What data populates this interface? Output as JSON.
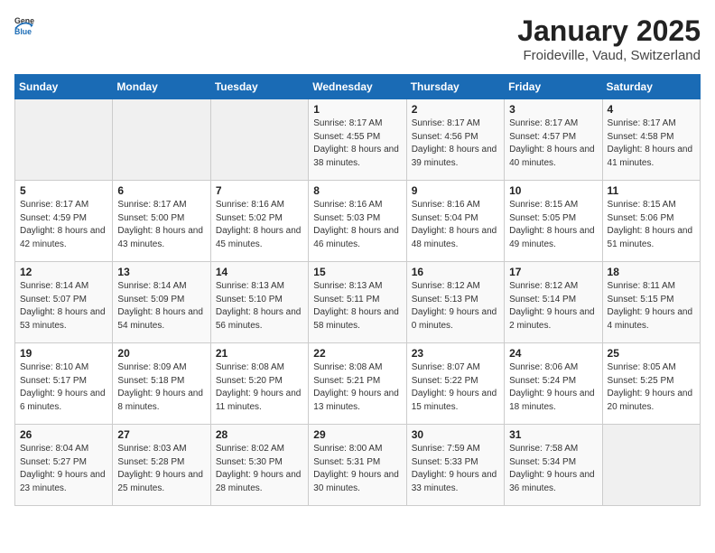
{
  "header": {
    "logo_general": "General",
    "logo_blue": "Blue",
    "title": "January 2025",
    "subtitle": "Froideville, Vaud, Switzerland"
  },
  "days_of_week": [
    "Sunday",
    "Monday",
    "Tuesday",
    "Wednesday",
    "Thursday",
    "Friday",
    "Saturday"
  ],
  "weeks": [
    [
      {
        "day": "",
        "sunrise": "",
        "sunset": "",
        "daylight": "",
        "empty": true
      },
      {
        "day": "",
        "sunrise": "",
        "sunset": "",
        "daylight": "",
        "empty": true
      },
      {
        "day": "",
        "sunrise": "",
        "sunset": "",
        "daylight": "",
        "empty": true
      },
      {
        "day": "1",
        "sunrise": "Sunrise: 8:17 AM",
        "sunset": "Sunset: 4:55 PM",
        "daylight": "Daylight: 8 hours and 38 minutes."
      },
      {
        "day": "2",
        "sunrise": "Sunrise: 8:17 AM",
        "sunset": "Sunset: 4:56 PM",
        "daylight": "Daylight: 8 hours and 39 minutes."
      },
      {
        "day": "3",
        "sunrise": "Sunrise: 8:17 AM",
        "sunset": "Sunset: 4:57 PM",
        "daylight": "Daylight: 8 hours and 40 minutes."
      },
      {
        "day": "4",
        "sunrise": "Sunrise: 8:17 AM",
        "sunset": "Sunset: 4:58 PM",
        "daylight": "Daylight: 8 hours and 41 minutes."
      }
    ],
    [
      {
        "day": "5",
        "sunrise": "Sunrise: 8:17 AM",
        "sunset": "Sunset: 4:59 PM",
        "daylight": "Daylight: 8 hours and 42 minutes."
      },
      {
        "day": "6",
        "sunrise": "Sunrise: 8:17 AM",
        "sunset": "Sunset: 5:00 PM",
        "daylight": "Daylight: 8 hours and 43 minutes."
      },
      {
        "day": "7",
        "sunrise": "Sunrise: 8:16 AM",
        "sunset": "Sunset: 5:02 PM",
        "daylight": "Daylight: 8 hours and 45 minutes."
      },
      {
        "day": "8",
        "sunrise": "Sunrise: 8:16 AM",
        "sunset": "Sunset: 5:03 PM",
        "daylight": "Daylight: 8 hours and 46 minutes."
      },
      {
        "day": "9",
        "sunrise": "Sunrise: 8:16 AM",
        "sunset": "Sunset: 5:04 PM",
        "daylight": "Daylight: 8 hours and 48 minutes."
      },
      {
        "day": "10",
        "sunrise": "Sunrise: 8:15 AM",
        "sunset": "Sunset: 5:05 PM",
        "daylight": "Daylight: 8 hours and 49 minutes."
      },
      {
        "day": "11",
        "sunrise": "Sunrise: 8:15 AM",
        "sunset": "Sunset: 5:06 PM",
        "daylight": "Daylight: 8 hours and 51 minutes."
      }
    ],
    [
      {
        "day": "12",
        "sunrise": "Sunrise: 8:14 AM",
        "sunset": "Sunset: 5:07 PM",
        "daylight": "Daylight: 8 hours and 53 minutes."
      },
      {
        "day": "13",
        "sunrise": "Sunrise: 8:14 AM",
        "sunset": "Sunset: 5:09 PM",
        "daylight": "Daylight: 8 hours and 54 minutes."
      },
      {
        "day": "14",
        "sunrise": "Sunrise: 8:13 AM",
        "sunset": "Sunset: 5:10 PM",
        "daylight": "Daylight: 8 hours and 56 minutes."
      },
      {
        "day": "15",
        "sunrise": "Sunrise: 8:13 AM",
        "sunset": "Sunset: 5:11 PM",
        "daylight": "Daylight: 8 hours and 58 minutes."
      },
      {
        "day": "16",
        "sunrise": "Sunrise: 8:12 AM",
        "sunset": "Sunset: 5:13 PM",
        "daylight": "Daylight: 9 hours and 0 minutes."
      },
      {
        "day": "17",
        "sunrise": "Sunrise: 8:12 AM",
        "sunset": "Sunset: 5:14 PM",
        "daylight": "Daylight: 9 hours and 2 minutes."
      },
      {
        "day": "18",
        "sunrise": "Sunrise: 8:11 AM",
        "sunset": "Sunset: 5:15 PM",
        "daylight": "Daylight: 9 hours and 4 minutes."
      }
    ],
    [
      {
        "day": "19",
        "sunrise": "Sunrise: 8:10 AM",
        "sunset": "Sunset: 5:17 PM",
        "daylight": "Daylight: 9 hours and 6 minutes."
      },
      {
        "day": "20",
        "sunrise": "Sunrise: 8:09 AM",
        "sunset": "Sunset: 5:18 PM",
        "daylight": "Daylight: 9 hours and 8 minutes."
      },
      {
        "day": "21",
        "sunrise": "Sunrise: 8:08 AM",
        "sunset": "Sunset: 5:20 PM",
        "daylight": "Daylight: 9 hours and 11 minutes."
      },
      {
        "day": "22",
        "sunrise": "Sunrise: 8:08 AM",
        "sunset": "Sunset: 5:21 PM",
        "daylight": "Daylight: 9 hours and 13 minutes."
      },
      {
        "day": "23",
        "sunrise": "Sunrise: 8:07 AM",
        "sunset": "Sunset: 5:22 PM",
        "daylight": "Daylight: 9 hours and 15 minutes."
      },
      {
        "day": "24",
        "sunrise": "Sunrise: 8:06 AM",
        "sunset": "Sunset: 5:24 PM",
        "daylight": "Daylight: 9 hours and 18 minutes."
      },
      {
        "day": "25",
        "sunrise": "Sunrise: 8:05 AM",
        "sunset": "Sunset: 5:25 PM",
        "daylight": "Daylight: 9 hours and 20 minutes."
      }
    ],
    [
      {
        "day": "26",
        "sunrise": "Sunrise: 8:04 AM",
        "sunset": "Sunset: 5:27 PM",
        "daylight": "Daylight: 9 hours and 23 minutes."
      },
      {
        "day": "27",
        "sunrise": "Sunrise: 8:03 AM",
        "sunset": "Sunset: 5:28 PM",
        "daylight": "Daylight: 9 hours and 25 minutes."
      },
      {
        "day": "28",
        "sunrise": "Sunrise: 8:02 AM",
        "sunset": "Sunset: 5:30 PM",
        "daylight": "Daylight: 9 hours and 28 minutes."
      },
      {
        "day": "29",
        "sunrise": "Sunrise: 8:00 AM",
        "sunset": "Sunset: 5:31 PM",
        "daylight": "Daylight: 9 hours and 30 minutes."
      },
      {
        "day": "30",
        "sunrise": "Sunrise: 7:59 AM",
        "sunset": "Sunset: 5:33 PM",
        "daylight": "Daylight: 9 hours and 33 minutes."
      },
      {
        "day": "31",
        "sunrise": "Sunrise: 7:58 AM",
        "sunset": "Sunset: 5:34 PM",
        "daylight": "Daylight: 9 hours and 36 minutes."
      },
      {
        "day": "",
        "sunrise": "",
        "sunset": "",
        "daylight": "",
        "empty": true
      }
    ]
  ]
}
